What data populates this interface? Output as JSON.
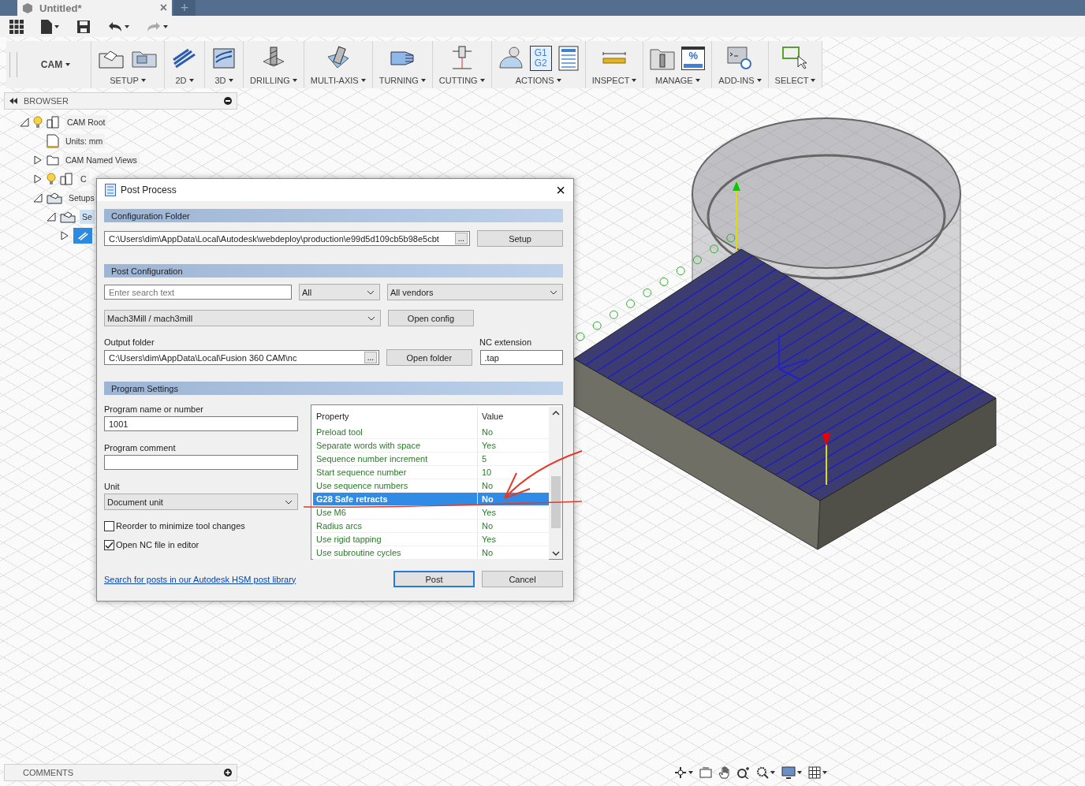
{
  "document_tab": {
    "title": "Untitled*",
    "close": "×",
    "new_tab": "+"
  },
  "ribbon": {
    "workspace": "CAM",
    "groups": [
      {
        "label": "SETUP"
      },
      {
        "label": "2D"
      },
      {
        "label": "3D"
      },
      {
        "label": "DRILLING"
      },
      {
        "label": "MULTI-AXIS"
      },
      {
        "label": "TURNING"
      },
      {
        "label": "CUTTING"
      },
      {
        "label": "ACTIONS",
        "icon_text": [
          "G1",
          "G2"
        ]
      },
      {
        "label": "INSPECT"
      },
      {
        "label": "MANAGE",
        "icon_text": [
          "%"
        ]
      },
      {
        "label": "ADD-INS"
      },
      {
        "label": "SELECT"
      }
    ]
  },
  "browser": {
    "title": "BROWSER",
    "items": [
      {
        "label": "CAM Root",
        "expanded": true,
        "selected": false,
        "children": [
          {
            "label": "Units: mm",
            "selected": false
          },
          {
            "label": "CAM Named Views",
            "expanded": false,
            "selected": false
          },
          {
            "label": "C",
            "expanded": false,
            "selected": false
          },
          {
            "label": "Setups",
            "expanded": true,
            "selected": false,
            "children": [
              {
                "label": "Se",
                "expanded": true,
                "selected": false,
                "children": [
                  {
                    "expanded": false,
                    "selected": true
                  }
                ]
              }
            ]
          }
        ]
      }
    ]
  },
  "dialog": {
    "title": "Post Process",
    "close": "×",
    "configuration_folder": {
      "heading": "Configuration Folder",
      "path": "C:\\Users\\dim\\AppData\\Local\\Autodesk\\webdeploy\\production\\e99d5d109cb5b98e5cbt",
      "browse": "...",
      "button": "Setup"
    },
    "post_configuration": {
      "heading": "Post Configuration",
      "search_placeholder": "Enter search text",
      "filter": "All",
      "vendor": "All vendors",
      "post": "Mach3Mill / mach3mill",
      "open_config": "Open config",
      "output_label": "Output folder",
      "output_path": "C:\\Users\\dim\\AppData\\Local\\Fusion 360 CAM\\nc",
      "browse": "...",
      "open_folder": "Open folder",
      "extension_label": "NC extension",
      "extension": ".tap"
    },
    "program_settings": {
      "heading": "Program Settings",
      "name_label": "Program name or number",
      "name": "1001",
      "comment_label": "Program comment",
      "unit_label": "Unit",
      "unit": "Document unit",
      "options": [
        {
          "label": "Reorder to minimize tool changes",
          "checked": false
        },
        {
          "label": "Open NC file in editor",
          "checked": true
        }
      ],
      "columns": [
        "Property",
        "Value"
      ],
      "properties": [
        {
          "name": "Preload tool",
          "value": "No",
          "selected": false
        },
        {
          "name": "Separate words with space",
          "value": "Yes",
          "selected": false
        },
        {
          "name": "Sequence number increment",
          "value": "5",
          "selected": false
        },
        {
          "name": "Start sequence number",
          "value": "10",
          "selected": false
        },
        {
          "name": "Use sequence numbers",
          "value": "No",
          "selected": false
        },
        {
          "name": "G28 Safe retracts",
          "value": "No",
          "selected": true
        },
        {
          "name": "Use M6",
          "value": "Yes",
          "selected": false
        },
        {
          "name": "Radius arcs",
          "value": "No",
          "selected": false
        },
        {
          "name": "Use rigid tapping",
          "value": "Yes",
          "selected": false
        },
        {
          "name": "Use subroutine cycles",
          "value": "No",
          "selected": false
        }
      ]
    },
    "link": "Search for posts in our Autodesk HSM post library",
    "buttons": [
      "Post",
      "Cancel"
    ]
  },
  "comments": {
    "title": "COMMENTS"
  }
}
